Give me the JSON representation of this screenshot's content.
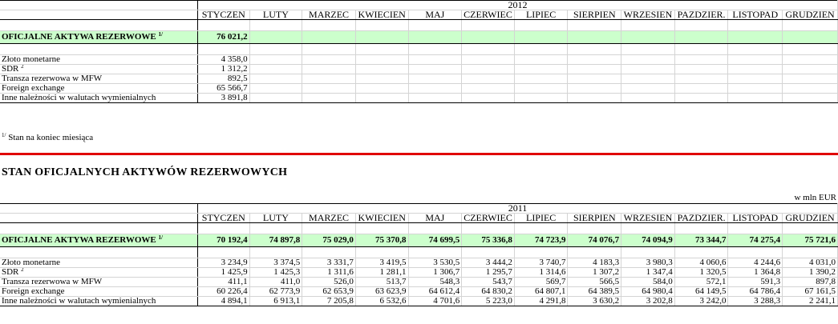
{
  "months": [
    "STYCZEN",
    "LUTY",
    "MARZEC",
    "KWIECIEN",
    "MAJ",
    "CZERWIEC",
    "LIPIEC",
    "SIERPIEN",
    "WRZESIEN",
    "PAZDZIER.",
    "LISTOPAD",
    "GRUDZIEN"
  ],
  "top": {
    "year": "2012",
    "total_label": "OFICJALNE AKTYWA REZERWOWE",
    "total_sup": "1/",
    "total_values": [
      "76 021,2",
      "",
      "",
      "",
      "",
      "",
      "",
      "",
      "",
      "",
      "",
      ""
    ],
    "rows": [
      {
        "label": "Złoto monetarne",
        "sup": "",
        "values": [
          "4 358,0",
          "",
          "",
          "",
          "",
          "",
          "",
          "",
          "",
          "",
          "",
          ""
        ]
      },
      {
        "label": "SDR",
        "sup": "2",
        "values": [
          "1 312,2",
          "",
          "",
          "",
          "",
          "",
          "",
          "",
          "",
          "",
          "",
          ""
        ]
      },
      {
        "label": "Transza rezerwowa w MFW",
        "sup": "",
        "values": [
          "892,5",
          "",
          "",
          "",
          "",
          "",
          "",
          "",
          "",
          "",
          "",
          ""
        ]
      },
      {
        "label": "Foreign exchange",
        "sup": "",
        "values": [
          "65 566,7",
          "",
          "",
          "",
          "",
          "",
          "",
          "",
          "",
          "",
          "",
          ""
        ]
      },
      {
        "label": "Inne należności w walutach wymienialnych",
        "sup": "",
        "values": [
          "3 891,8",
          "",
          "",
          "",
          "",
          "",
          "",
          "",
          "",
          "",
          "",
          ""
        ]
      }
    ]
  },
  "footnote": {
    "sup": "1/",
    "text": "Stan na koniec miesiąca"
  },
  "section_title": "STAN OFICJALNYCH AKTYWÓW REZERWOWYCH",
  "unit": "w mln EUR",
  "bottom": {
    "year": "2011",
    "total_label": "OFICJALNE AKTYWA REZERWOWE",
    "total_sup": "1/",
    "total_values": [
      "70 192,4",
      "74 897,8",
      "75 029,0",
      "75 370,8",
      "74 699,5",
      "75 336,8",
      "74 723,9",
      "74 076,7",
      "74 094,9",
      "73 344,7",
      "74 275,4",
      "75 721,6"
    ],
    "rows": [
      {
        "label": "Złoto monetarne",
        "sup": "",
        "values": [
          "3 234,9",
          "3 374,5",
          "3 331,7",
          "3 419,5",
          "3 530,5",
          "3 444,2",
          "3 740,7",
          "4 183,3",
          "3 980,3",
          "4 060,6",
          "4 244,6",
          "4 031,0"
        ]
      },
      {
        "label": "SDR",
        "sup": "2",
        "values": [
          "1 425,9",
          "1 425,3",
          "1 311,6",
          "1 281,1",
          "1 306,7",
          "1 295,7",
          "1 314,6",
          "1 307,2",
          "1 347,4",
          "1 320,5",
          "1 364,8",
          "1 390,2"
        ]
      },
      {
        "label": "Transza rezerwowa w MFW",
        "sup": "",
        "values": [
          "411,1",
          "411,0",
          "526,0",
          "513,7",
          "548,3",
          "543,7",
          "569,7",
          "566,5",
          "584,0",
          "572,1",
          "591,3",
          "897,8"
        ]
      },
      {
        "label": "Foreign exchange",
        "sup": "",
        "values": [
          "60 226,4",
          "62 773,9",
          "62 653,9",
          "63 623,9",
          "64 612,4",
          "64 830,2",
          "64 807,1",
          "64 389,5",
          "64 980,4",
          "64 149,5",
          "64 786,4",
          "67 161,5"
        ]
      },
      {
        "label": "Inne należności w walutach wymienialnych",
        "sup": "",
        "values": [
          "4 894,1",
          "6 913,1",
          "7 205,8",
          "6 532,6",
          "4 701,6",
          "5 223,0",
          "4 291,8",
          "3 630,2",
          "3 202,8",
          "3 242,0",
          "3 288,3",
          "2 241,1"
        ]
      }
    ]
  }
}
